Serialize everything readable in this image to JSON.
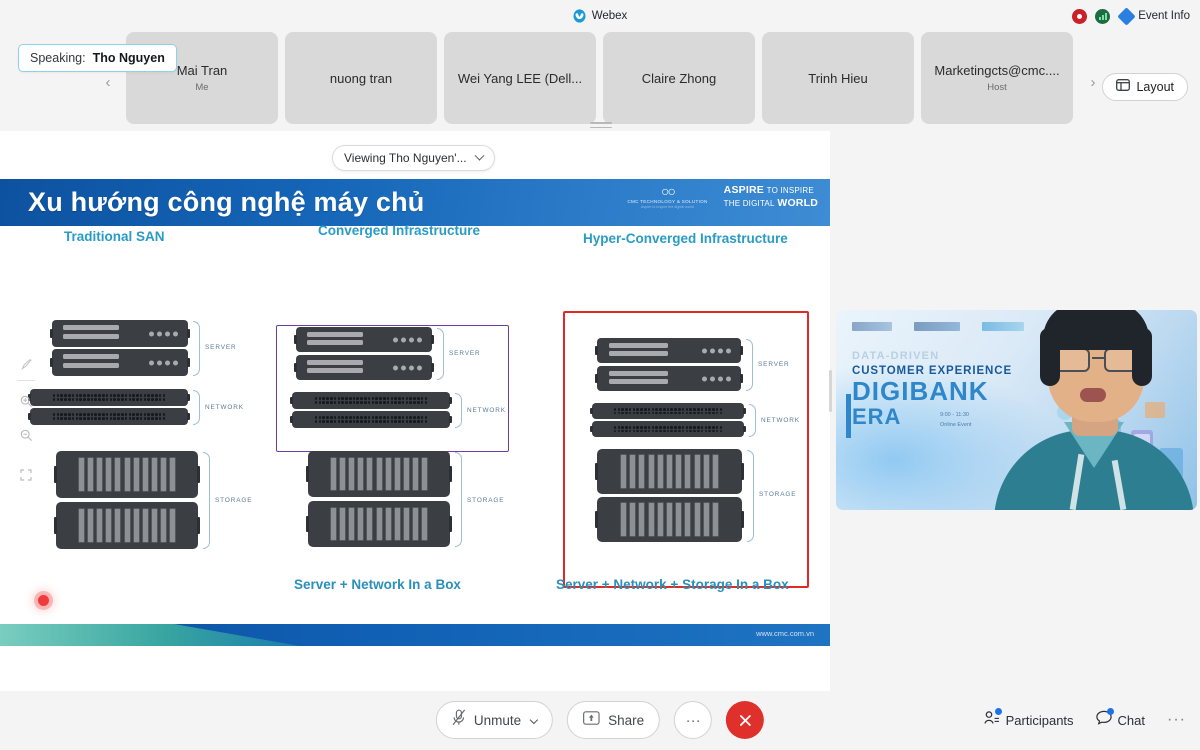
{
  "app": {
    "name": "Webex",
    "brand_color": "#1a9ad7"
  },
  "top_bar": {
    "recording_icon": "record-icon",
    "network_icon": "network-quality-icon",
    "event_info_label": "Event Info",
    "event_info_icon": "event-info-diamond-icon"
  },
  "filmstrip": {
    "speaking_label": "Speaking:",
    "speaking_name": "Tho Nguyen",
    "prev_arrow": "‹",
    "next_arrow": "›",
    "layout_label": "Layout",
    "layout_icon": "layout-grid-icon",
    "tiles": [
      {
        "name": "Mai Tran",
        "sub": "Me"
      },
      {
        "name": "nuong tran",
        "sub": ""
      },
      {
        "name": "Wei Yang LEE (Dell...",
        "sub": ""
      },
      {
        "name": "Claire Zhong",
        "sub": ""
      },
      {
        "name": "Trinh Hieu",
        "sub": ""
      },
      {
        "name": "Marketingcts@cmc....",
        "sub": "Host"
      }
    ]
  },
  "stage": {
    "viewing_label": "Viewing Tho Nguyen'...",
    "left_tools": [
      {
        "name": "annotate-pointer-tool",
        "glyph": "✎"
      },
      {
        "name": "zoom-in-tool",
        "glyph": "⊕"
      },
      {
        "name": "zoom-out-tool",
        "glyph": "⊖"
      },
      {
        "name": "fit-to-screen-tool",
        "glyph": "⛶"
      }
    ]
  },
  "slide": {
    "title": "Xu hướng công nghệ máy chủ",
    "brand": {
      "company": "CMC TECHNOLOGY & SOLUTION",
      "company_sub": "Aspire to inspire the digital world",
      "tagline_line1_a": "ASPIRE",
      "tagline_line1_b": "TO INSPIRE",
      "tagline_line2_a": "THE DIGITAL",
      "tagline_line2_b": "WORLD"
    },
    "columns": [
      {
        "heading": "Traditional SAN"
      },
      {
        "heading": "Converged Infrastructure"
      },
      {
        "heading": "Hyper-Converged Infrastructure"
      }
    ],
    "group_labels": {
      "server": "SERVER",
      "network": "NETWORK",
      "storage": "STORAGE"
    },
    "captions": {
      "converged": "Server + Network In a Box",
      "hyperconverged": "Server + Network + Storage In a Box"
    },
    "footer_url": "www.cmc.com.vn",
    "box_colors": {
      "converged_border": "#6b3fa0",
      "hyperconverged_border": "#e02a26",
      "heading_text": "#2a9bc4",
      "caption_text": "#2a8fba"
    }
  },
  "video_thumbnail": {
    "background_text": {
      "line1": "DATA-DRIVEN",
      "line2": "CUSTOMER EXPERIENCE",
      "line3": "DIGIBANK",
      "line4": "ERA",
      "detail1": "9:00 - 11:30",
      "detail2": "Online Event"
    }
  },
  "bottom_bar": {
    "mute_label": "Unmute",
    "mute_icon": "microphone-muted-icon",
    "share_label": "Share",
    "share_icon": "share-screen-icon",
    "more_label": "···",
    "end_label": "✕",
    "participants_label": "Participants",
    "participants_icon": "participants-icon",
    "chat_label": "Chat",
    "chat_icon": "chat-bubble-icon",
    "overflow_label": "···"
  }
}
